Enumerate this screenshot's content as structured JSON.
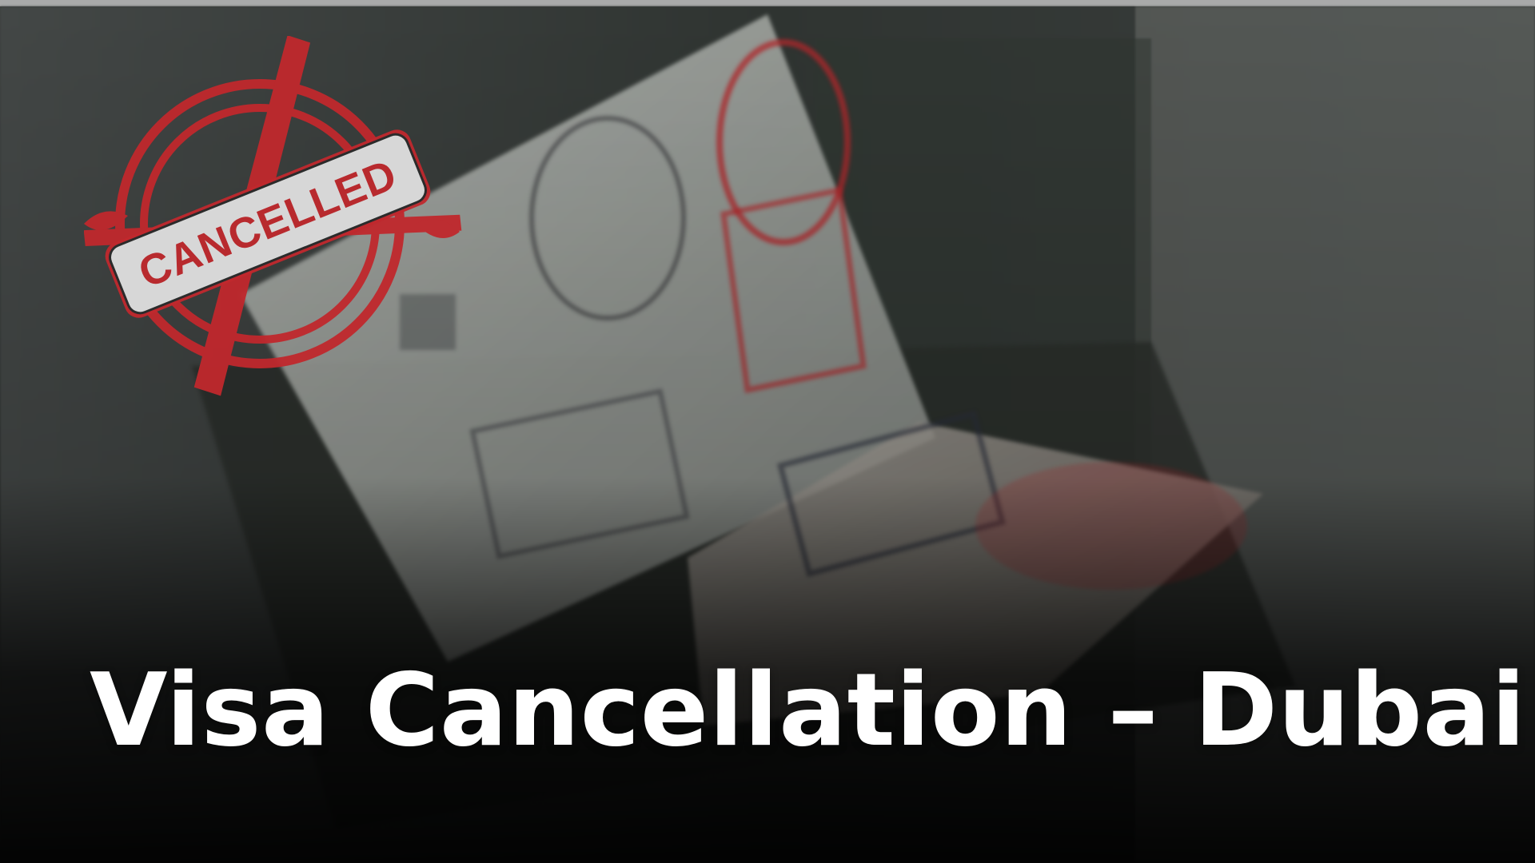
{
  "hero": {
    "title": "Visa Cancellation – Dubai"
  },
  "badge": {
    "text": "CANCELLED",
    "color": "#c0282d"
  },
  "colors": {
    "overlay_dark": "#060606",
    "title": "#ffffff"
  },
  "icons": {
    "stamp": "cancelled-stamp-icon"
  }
}
